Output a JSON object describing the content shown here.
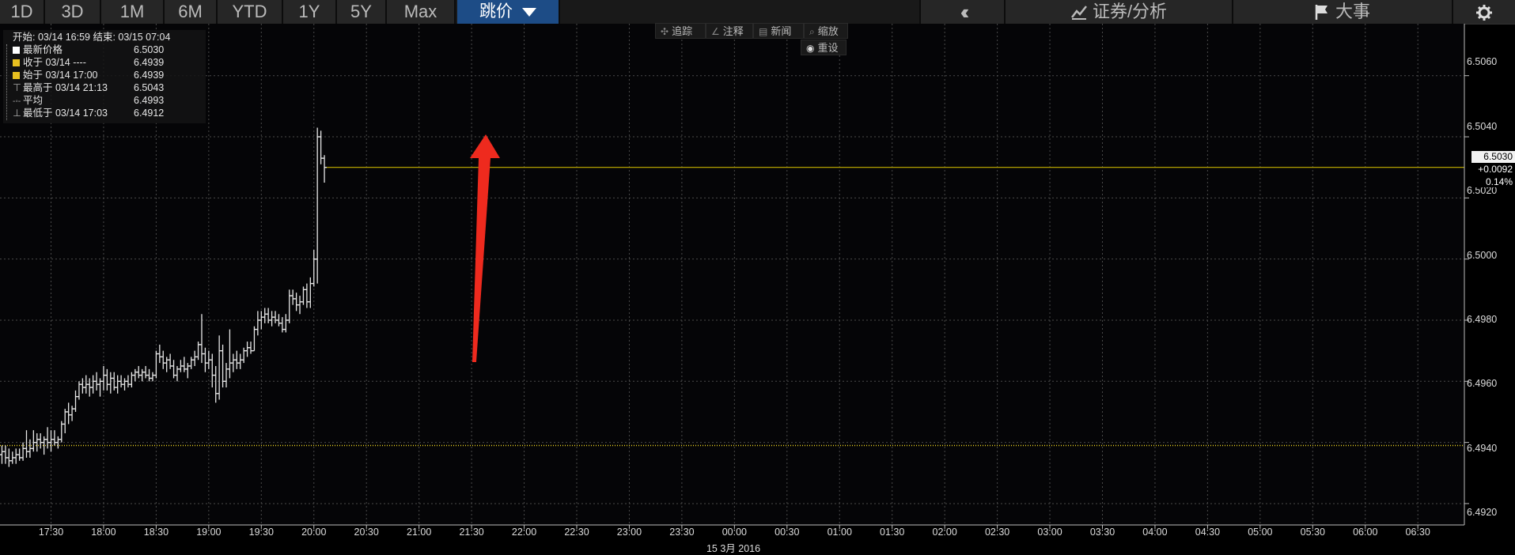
{
  "toolbar": {
    "ranges": [
      "1D",
      "3D",
      "1M",
      "6M",
      "YTD",
      "1Y",
      "5Y",
      "Max"
    ],
    "active_label": "跳价",
    "back_icon": "double-chevron-left-icon",
    "securities_label": "证券/分析",
    "events_label": "大事",
    "settings_icon": "gear-icon"
  },
  "chart_tools": {
    "track": "追踪",
    "annotate": "注释",
    "news": "新闻",
    "zoom": "缩放",
    "reset": "重设"
  },
  "legend": {
    "header": "开始: 03/14 16:59 结束: 03/15 07:04",
    "rows": [
      {
        "label": "最新价格",
        "value": "6.5030",
        "color": "#ffffff"
      },
      {
        "label": "收于 03/14 ----",
        "value": "6.4939",
        "color": "#e8c020"
      },
      {
        "label": "始于 03/14 17:00",
        "value": "6.4939",
        "color": "#e8c020"
      },
      {
        "label": "最高于 03/14 21:13",
        "value": "6.5043",
        "color": ""
      },
      {
        "label": "平均",
        "value": "6.4993",
        "color": ""
      },
      {
        "label": "最低于 03/14 17:03",
        "value": "6.4912",
        "color": ""
      }
    ]
  },
  "last_price_tag": {
    "price": "6.5030",
    "change": "+0.0092",
    "pct": "0.14%"
  },
  "colors": {
    "background": "#000000",
    "bars": "#e8e8e8",
    "last_line": "#c8b400",
    "close_line": "#e8d020",
    "arrow": "#ee2a1e",
    "active_button": "#1d4c86"
  },
  "chart_data": {
    "type": "ohlc-bar",
    "x_axis": {
      "ticks": [
        "17:30",
        "18:00",
        "18:30",
        "19:00",
        "19:30",
        "20:00",
        "20:30",
        "21:00",
        "21:30",
        "22:00",
        "22:30",
        "23:00",
        "23:30",
        "00:00",
        "00:30",
        "01:00",
        "01:30",
        "02:00",
        "02:30",
        "03:00",
        "03:30",
        "04:00",
        "04:30",
        "05:00",
        "05:30",
        "06:00",
        "06:30"
      ],
      "date_label": "15 3月 2016",
      "range": [
        "16:59",
        "07:04"
      ]
    },
    "y_axis": {
      "ticks": [
        6.492,
        6.494,
        6.496,
        6.498,
        6.5,
        6.502,
        6.504,
        6.506
      ],
      "range": [
        6.4913,
        6.5077
      ]
    },
    "reference_lines": [
      {
        "name": "last",
        "value": 6.503,
        "style": "solid"
      },
      {
        "name": "close",
        "value": 6.4939,
        "style": "dotted"
      }
    ],
    "bars": [
      {
        "t": "17:00",
        "o": 6.4939,
        "h": 6.4949,
        "l": 6.4912,
        "c": 6.4936
      },
      {
        "t": "17:02",
        "o": 6.4936,
        "h": 6.4939,
        "l": 6.4933,
        "c": 6.4937
      },
      {
        "t": "17:04",
        "o": 6.4937,
        "h": 6.4939,
        "l": 6.4933,
        "c": 6.4935
      },
      {
        "t": "17:06",
        "o": 6.4935,
        "h": 6.4938,
        "l": 6.4932,
        "c": 6.4934
      },
      {
        "t": "17:08",
        "o": 6.4934,
        "h": 6.4937,
        "l": 6.4933,
        "c": 6.4935
      },
      {
        "t": "17:10",
        "o": 6.4935,
        "h": 6.4938,
        "l": 6.4933,
        "c": 6.4936
      },
      {
        "t": "17:12",
        "o": 6.4936,
        "h": 6.4938,
        "l": 6.4934,
        "c": 6.4935
      },
      {
        "t": "17:14",
        "o": 6.4935,
        "h": 6.494,
        "l": 6.4934,
        "c": 6.4938
      },
      {
        "t": "17:16",
        "o": 6.4938,
        "h": 6.4944,
        "l": 6.4935,
        "c": 6.4937
      },
      {
        "t": "17:18",
        "o": 6.4937,
        "h": 6.4941,
        "l": 6.4935,
        "c": 6.4938
      },
      {
        "t": "17:20",
        "o": 6.4938,
        "h": 6.4944,
        "l": 6.4937,
        "c": 6.494
      },
      {
        "t": "17:22",
        "o": 6.494,
        "h": 6.4943,
        "l": 6.4937,
        "c": 6.4941
      },
      {
        "t": "17:24",
        "o": 6.4941,
        "h": 6.4943,
        "l": 6.4938,
        "c": 6.494
      },
      {
        "t": "17:26",
        "o": 6.494,
        "h": 6.4942,
        "l": 6.4936,
        "c": 6.4941
      },
      {
        "t": "17:28",
        "o": 6.4941,
        "h": 6.4945,
        "l": 6.4938,
        "c": 6.494
      },
      {
        "t": "17:30",
        "o": 6.494,
        "h": 6.4944,
        "l": 6.4937,
        "c": 6.4941
      },
      {
        "t": "17:32",
        "o": 6.4941,
        "h": 6.4944,
        "l": 6.4939,
        "c": 6.494
      },
      {
        "t": "17:34",
        "o": 6.494,
        "h": 6.4942,
        "l": 6.4938,
        "c": 6.4941
      },
      {
        "t": "17:36",
        "o": 6.4941,
        "h": 6.4947,
        "l": 6.494,
        "c": 6.4946
      },
      {
        "t": "17:38",
        "o": 6.4946,
        "h": 6.4951,
        "l": 6.4943,
        "c": 6.495
      },
      {
        "t": "17:40",
        "o": 6.495,
        "h": 6.4953,
        "l": 6.4946,
        "c": 6.4949
      },
      {
        "t": "17:42",
        "o": 6.4949,
        "h": 6.4952,
        "l": 6.4947,
        "c": 6.4951
      },
      {
        "t": "17:44",
        "o": 6.4951,
        "h": 6.4957,
        "l": 6.495,
        "c": 6.4955
      },
      {
        "t": "17:46",
        "o": 6.4955,
        "h": 6.496,
        "l": 6.4954,
        "c": 6.4959
      },
      {
        "t": "17:48",
        "o": 6.4959,
        "h": 6.4961,
        "l": 6.4956,
        "c": 6.4958
      },
      {
        "t": "17:50",
        "o": 6.4958,
        "h": 6.4962,
        "l": 6.4956,
        "c": 6.4959
      },
      {
        "t": "17:52",
        "o": 6.4959,
        "h": 6.4961,
        "l": 6.4955,
        "c": 6.4958
      },
      {
        "t": "17:54",
        "o": 6.4958,
        "h": 6.4962,
        "l": 6.4956,
        "c": 6.496
      },
      {
        "t": "17:56",
        "o": 6.496,
        "h": 6.4963,
        "l": 6.4957,
        "c": 6.4959
      },
      {
        "t": "17:58",
        "o": 6.4959,
        "h": 6.4961,
        "l": 6.4955,
        "c": 6.496
      },
      {
        "t": "18:00",
        "o": 6.496,
        "h": 6.4965,
        "l": 6.4957,
        "c": 6.4962
      },
      {
        "t": "18:02",
        "o": 6.4962,
        "h": 6.4964,
        "l": 6.4957,
        "c": 6.4959
      },
      {
        "t": "18:04",
        "o": 6.4959,
        "h": 6.4963,
        "l": 6.4956,
        "c": 6.4961
      },
      {
        "t": "18:06",
        "o": 6.4961,
        "h": 6.4963,
        "l": 6.4957,
        "c": 6.4958
      },
      {
        "t": "18:08",
        "o": 6.4958,
        "h": 6.4962,
        "l": 6.4956,
        "c": 6.496
      },
      {
        "t": "18:10",
        "o": 6.496,
        "h": 6.4962,
        "l": 6.4958,
        "c": 6.4959
      },
      {
        "t": "18:12",
        "o": 6.4959,
        "h": 6.4961,
        "l": 6.4957,
        "c": 6.496
      },
      {
        "t": "18:14",
        "o": 6.496,
        "h": 6.4962,
        "l": 6.4958,
        "c": 6.4959
      },
      {
        "t": "18:16",
        "o": 6.4959,
        "h": 6.4963,
        "l": 6.4958,
        "c": 6.4962
      },
      {
        "t": "18:18",
        "o": 6.4962,
        "h": 6.4964,
        "l": 6.496,
        "c": 6.4963
      },
      {
        "t": "18:20",
        "o": 6.4963,
        "h": 6.4965,
        "l": 6.4961,
        "c": 6.4962
      },
      {
        "t": "18:22",
        "o": 6.4962,
        "h": 6.4964,
        "l": 6.496,
        "c": 6.4963
      },
      {
        "t": "18:24",
        "o": 6.4963,
        "h": 6.4965,
        "l": 6.4961,
        "c": 6.4962
      },
      {
        "t": "18:26",
        "o": 6.4962,
        "h": 6.4964,
        "l": 6.496,
        "c": 6.4961
      },
      {
        "t": "18:28",
        "o": 6.4961,
        "h": 6.4963,
        "l": 6.496,
        "c": 6.4962
      },
      {
        "t": "18:30",
        "o": 6.4962,
        "h": 6.497,
        "l": 6.4961,
        "c": 6.4969
      },
      {
        "t": "18:32",
        "o": 6.4969,
        "h": 6.4972,
        "l": 6.4966,
        "c": 6.4968
      },
      {
        "t": "18:34",
        "o": 6.4968,
        "h": 6.497,
        "l": 6.4964,
        "c": 6.4966
      },
      {
        "t": "18:36",
        "o": 6.4966,
        "h": 6.4968,
        "l": 6.4963,
        "c": 6.4967
      },
      {
        "t": "18:38",
        "o": 6.4967,
        "h": 6.4969,
        "l": 6.4964,
        "c": 6.4965
      },
      {
        "t": "18:40",
        "o": 6.4965,
        "h": 6.4967,
        "l": 6.4961,
        "c": 6.4962
      },
      {
        "t": "18:42",
        "o": 6.4962,
        "h": 6.4965,
        "l": 6.496,
        "c": 6.4964
      },
      {
        "t": "18:44",
        "o": 6.4964,
        "h": 6.4967,
        "l": 6.4963,
        "c": 6.4965
      },
      {
        "t": "18:46",
        "o": 6.4965,
        "h": 6.4968,
        "l": 6.4963,
        "c": 6.4964
      },
      {
        "t": "18:48",
        "o": 6.4964,
        "h": 6.4966,
        "l": 6.4961,
        "c": 6.4965
      },
      {
        "t": "18:50",
        "o": 6.4965,
        "h": 6.4968,
        "l": 6.4964,
        "c": 6.4967
      },
      {
        "t": "18:52",
        "o": 6.4967,
        "h": 6.497,
        "l": 6.4965,
        "c": 6.4968
      },
      {
        "t": "18:54",
        "o": 6.4968,
        "h": 6.4973,
        "l": 6.4967,
        "c": 6.4972
      },
      {
        "t": "18:56",
        "o": 6.4972,
        "h": 6.4982,
        "l": 6.4966,
        "c": 6.4969
      },
      {
        "t": "18:58",
        "o": 6.4969,
        "h": 6.4971,
        "l": 6.4963,
        "c": 6.4966
      },
      {
        "t": "19:00",
        "o": 6.4966,
        "h": 6.497,
        "l": 6.4964,
        "c": 6.4967
      },
      {
        "t": "19:02",
        "o": 6.4967,
        "h": 6.4969,
        "l": 6.4958,
        "c": 6.4962
      },
      {
        "t": "19:04",
        "o": 6.4962,
        "h": 6.4965,
        "l": 6.4953,
        "c": 6.4956
      },
      {
        "t": "19:06",
        "o": 6.4956,
        "h": 6.4975,
        "l": 6.4954,
        "c": 6.497
      },
      {
        "t": "19:08",
        "o": 6.497,
        "h": 6.4972,
        "l": 6.4958,
        "c": 6.496
      },
      {
        "t": "19:10",
        "o": 6.496,
        "h": 6.4966,
        "l": 6.4958,
        "c": 6.4964
      },
      {
        "t": "19:12",
        "o": 6.4964,
        "h": 6.4977,
        "l": 6.4961,
        "c": 6.4966
      },
      {
        "t": "19:14",
        "o": 6.4966,
        "h": 6.4969,
        "l": 6.4963,
        "c": 6.4967
      },
      {
        "t": "19:16",
        "o": 6.4967,
        "h": 6.497,
        "l": 6.4964,
        "c": 6.4966
      },
      {
        "t": "19:18",
        "o": 6.4966,
        "h": 6.4969,
        "l": 6.4964,
        "c": 6.4967
      },
      {
        "t": "19:20",
        "o": 6.4967,
        "h": 6.4971,
        "l": 6.4966,
        "c": 6.497
      },
      {
        "t": "19:22",
        "o": 6.497,
        "h": 6.4973,
        "l": 6.4968,
        "c": 6.4971
      },
      {
        "t": "19:24",
        "o": 6.4971,
        "h": 6.4973,
        "l": 6.4969,
        "c": 6.497
      },
      {
        "t": "19:26",
        "o": 6.497,
        "h": 6.4978,
        "l": 6.497,
        "c": 6.4977
      },
      {
        "t": "19:28",
        "o": 6.4977,
        "h": 6.4983,
        "l": 6.4975,
        "c": 6.498
      },
      {
        "t": "19:30",
        "o": 6.498,
        "h": 6.4983,
        "l": 6.4977,
        "c": 6.4981
      },
      {
        "t": "19:32",
        "o": 6.4981,
        "h": 6.4984,
        "l": 6.4979,
        "c": 6.4982
      },
      {
        "t": "19:34",
        "o": 6.4982,
        "h": 6.4984,
        "l": 6.4979,
        "c": 6.498
      },
      {
        "t": "19:36",
        "o": 6.498,
        "h": 6.4983,
        "l": 6.4978,
        "c": 6.4981
      },
      {
        "t": "19:38",
        "o": 6.4981,
        "h": 6.4983,
        "l": 6.4979,
        "c": 6.498
      },
      {
        "t": "19:40",
        "o": 6.498,
        "h": 6.4982,
        "l": 6.4978,
        "c": 6.4979
      },
      {
        "t": "19:42",
        "o": 6.4979,
        "h": 6.4981,
        "l": 6.4976,
        "c": 6.4977
      },
      {
        "t": "19:44",
        "o": 6.4977,
        "h": 6.4982,
        "l": 6.4976,
        "c": 6.498
      },
      {
        "t": "19:46",
        "o": 6.498,
        "h": 6.499,
        "l": 6.4979,
        "c": 6.4988
      },
      {
        "t": "19:48",
        "o": 6.4988,
        "h": 6.499,
        "l": 6.4985,
        "c": 6.4987
      },
      {
        "t": "19:50",
        "o": 6.4987,
        "h": 6.4989,
        "l": 6.4983,
        "c": 6.4985
      },
      {
        "t": "19:52",
        "o": 6.4985,
        "h": 6.4988,
        "l": 6.4982,
        "c": 6.4986
      },
      {
        "t": "19:54",
        "o": 6.4986,
        "h": 6.4991,
        "l": 6.4985,
        "c": 6.499
      },
      {
        "t": "19:56",
        "o": 6.499,
        "h": 6.4992,
        "l": 6.4984,
        "c": 6.4986
      },
      {
        "t": "19:58",
        "o": 6.4986,
        "h": 6.4994,
        "l": 6.4984,
        "c": 6.4992
      },
      {
        "t": "20:00",
        "o": 6.4992,
        "h": 6.5003,
        "l": 6.4991,
        "c": 6.5
      },
      {
        "t": "20:02",
        "o": 6.5,
        "h": 6.5043,
        "l": 6.4992,
        "c": 6.504
      },
      {
        "t": "20:04",
        "o": 6.504,
        "h": 6.5042,
        "l": 6.5031,
        "c": 6.5033
      },
      {
        "t": "20:06",
        "o": 6.5033,
        "h": 6.5034,
        "l": 6.5025,
        "c": 6.503
      }
    ]
  }
}
